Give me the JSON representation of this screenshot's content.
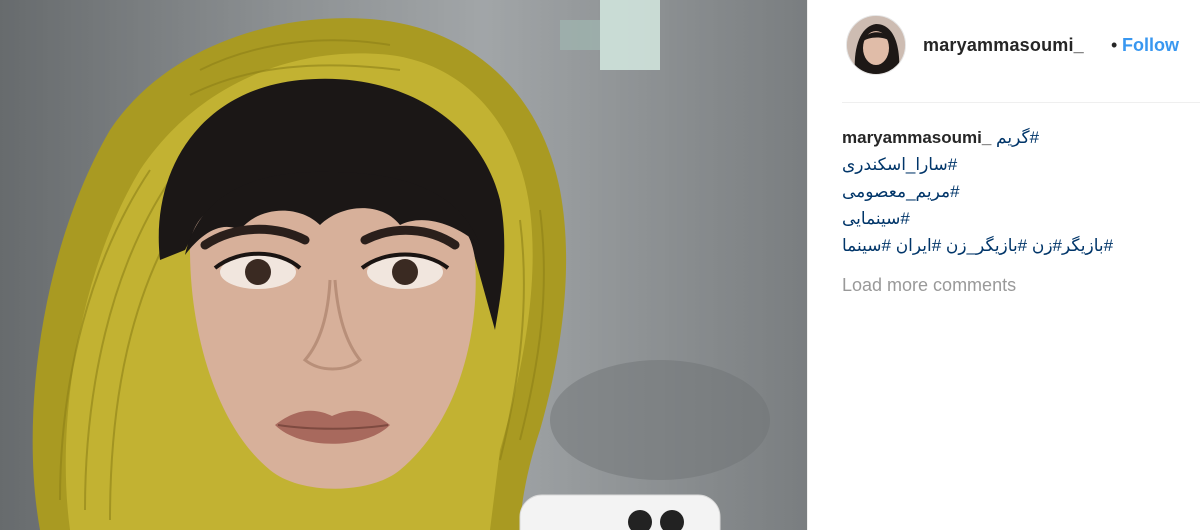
{
  "post": {
    "image_alt": "Portrait of a woman wearing a mustard-yellow pleated headscarf holding a white phone"
  },
  "header": {
    "username": "maryammasoumi_",
    "separator": "•",
    "follow_label": "Follow"
  },
  "caption": {
    "username": "maryammasoumi_",
    "first_tag": "#گریم",
    "tags": [
      "#سارا_اسکندری",
      "#مریم_معصومی",
      "#سینمایی",
      "#بازیگر#زن  #بازیگر_زن #ایران  #سینما"
    ]
  },
  "comments": {
    "load_more_label": "Load more comments"
  },
  "colors": {
    "link_blue": "#3897f0",
    "hashtag": "#003569",
    "muted": "#999999",
    "scarf": "#b7a62a"
  }
}
